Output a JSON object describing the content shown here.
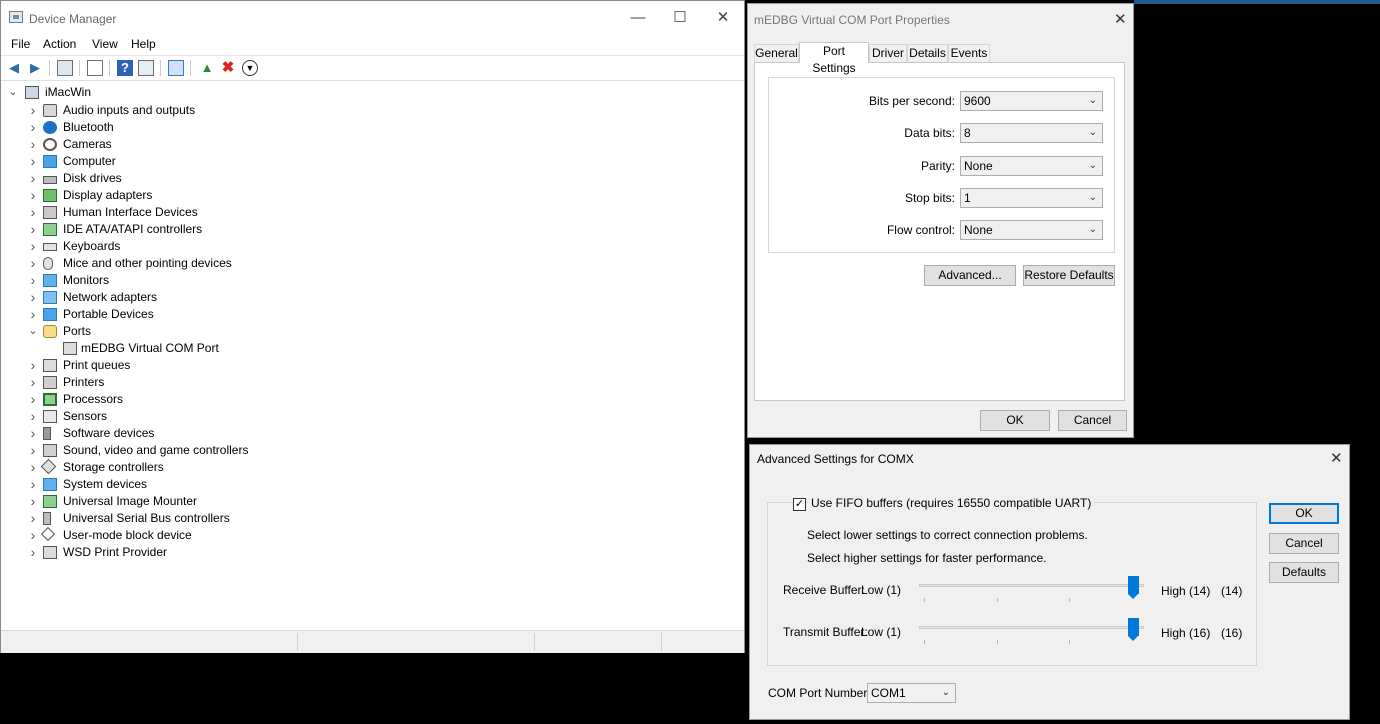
{
  "device_manager": {
    "title": "Device Manager",
    "menu": [
      "File",
      "Action",
      "View",
      "Help"
    ],
    "toolbar_icons": [
      "back-arrow-icon",
      "forward-arrow-icon",
      "properties-grid-icon",
      "list-view-icon",
      "help-icon",
      "details-view-icon",
      "monitor-scan-icon",
      "add-driver-icon",
      "uninstall-x-icon",
      "download-driver-icon"
    ],
    "root": "iMacWin",
    "categories": [
      {
        "label": "Audio inputs and outputs",
        "icon": "speaker-icon",
        "expanded": false
      },
      {
        "label": "Bluetooth",
        "icon": "bluetooth-icon",
        "expanded": false
      },
      {
        "label": "Cameras",
        "icon": "camera-icon",
        "expanded": false
      },
      {
        "label": "Computer",
        "icon": "computer-icon",
        "expanded": false
      },
      {
        "label": "Disk drives",
        "icon": "disk-drive-icon",
        "expanded": false
      },
      {
        "label": "Display adapters",
        "icon": "display-adapter-icon",
        "expanded": false
      },
      {
        "label": "Human Interface Devices",
        "icon": "hid-icon",
        "expanded": false
      },
      {
        "label": "IDE ATA/ATAPI controllers",
        "icon": "ide-controller-icon",
        "expanded": false
      },
      {
        "label": "Keyboards",
        "icon": "keyboard-icon",
        "expanded": false
      },
      {
        "label": "Mice and other pointing devices",
        "icon": "mouse-icon",
        "expanded": false
      },
      {
        "label": "Monitors",
        "icon": "monitor-icon",
        "expanded": false
      },
      {
        "label": "Network adapters",
        "icon": "network-adapter-icon",
        "expanded": false
      },
      {
        "label": "Portable Devices",
        "icon": "portable-device-icon",
        "expanded": false
      },
      {
        "label": "Ports",
        "icon": "ports-icon",
        "expanded": true
      },
      {
        "label": "mEDBG Virtual COM Port",
        "icon": "com-port-icon",
        "child": true
      },
      {
        "label": "Print queues",
        "icon": "print-queue-icon",
        "expanded": false
      },
      {
        "label": "Printers",
        "icon": "printer-icon",
        "expanded": false
      },
      {
        "label": "Processors",
        "icon": "processor-icon",
        "expanded": false
      },
      {
        "label": "Sensors",
        "icon": "sensor-icon",
        "expanded": false
      },
      {
        "label": "Software devices",
        "icon": "software-device-icon",
        "expanded": false
      },
      {
        "label": "Sound, video and game controllers",
        "icon": "sound-icon",
        "expanded": false
      },
      {
        "label": "Storage controllers",
        "icon": "storage-controller-icon",
        "expanded": false
      },
      {
        "label": "System devices",
        "icon": "system-device-icon",
        "expanded": false
      },
      {
        "label": "Universal Image Mounter",
        "icon": "image-mounter-icon",
        "expanded": false
      },
      {
        "label": "Universal Serial Bus controllers",
        "icon": "usb-icon",
        "expanded": false
      },
      {
        "label": "User-mode block device",
        "icon": "block-device-icon",
        "expanded": false
      },
      {
        "label": "WSD Print Provider",
        "icon": "wsd-print-icon",
        "expanded": false
      }
    ]
  },
  "properties": {
    "title": "mEDBG Virtual COM Port Properties",
    "tabs": [
      "General",
      "Port Settings",
      "Driver",
      "Details",
      "Events"
    ],
    "active_tab": "Port Settings",
    "fields": [
      {
        "label": "Bits per second:",
        "value": "9600"
      },
      {
        "label": "Data bits:",
        "value": "8"
      },
      {
        "label": "Parity:",
        "value": "None"
      },
      {
        "label": "Stop bits:",
        "value": "1"
      },
      {
        "label": "Flow control:",
        "value": "None"
      }
    ],
    "advanced_label": "Advanced...",
    "restore_label": "Restore Defaults",
    "ok_label": "OK",
    "cancel_label": "Cancel"
  },
  "advanced": {
    "title": "Advanced Settings for COMX",
    "fifo_label": "Use FIFO buffers (requires 16550 compatible UART)",
    "fifo_checked": true,
    "hint1": "Select lower settings to correct connection problems.",
    "hint2": "Select higher settings for faster performance.",
    "receive": {
      "label": "Receive Buffer:",
      "low": "Low (1)",
      "high": "High (14)",
      "value": "(14)",
      "level": 1.0
    },
    "transmit": {
      "label": "Transmit Buffer:",
      "low": "Low (1)",
      "high": "High (16)",
      "value": "(16)",
      "level": 1.0
    },
    "com_port_label": "COM Port Number:",
    "com_port_value": "COM1",
    "ok_label": "OK",
    "cancel_label": "Cancel",
    "defaults_label": "Defaults"
  },
  "colors": {
    "accent": "#0078d7"
  }
}
